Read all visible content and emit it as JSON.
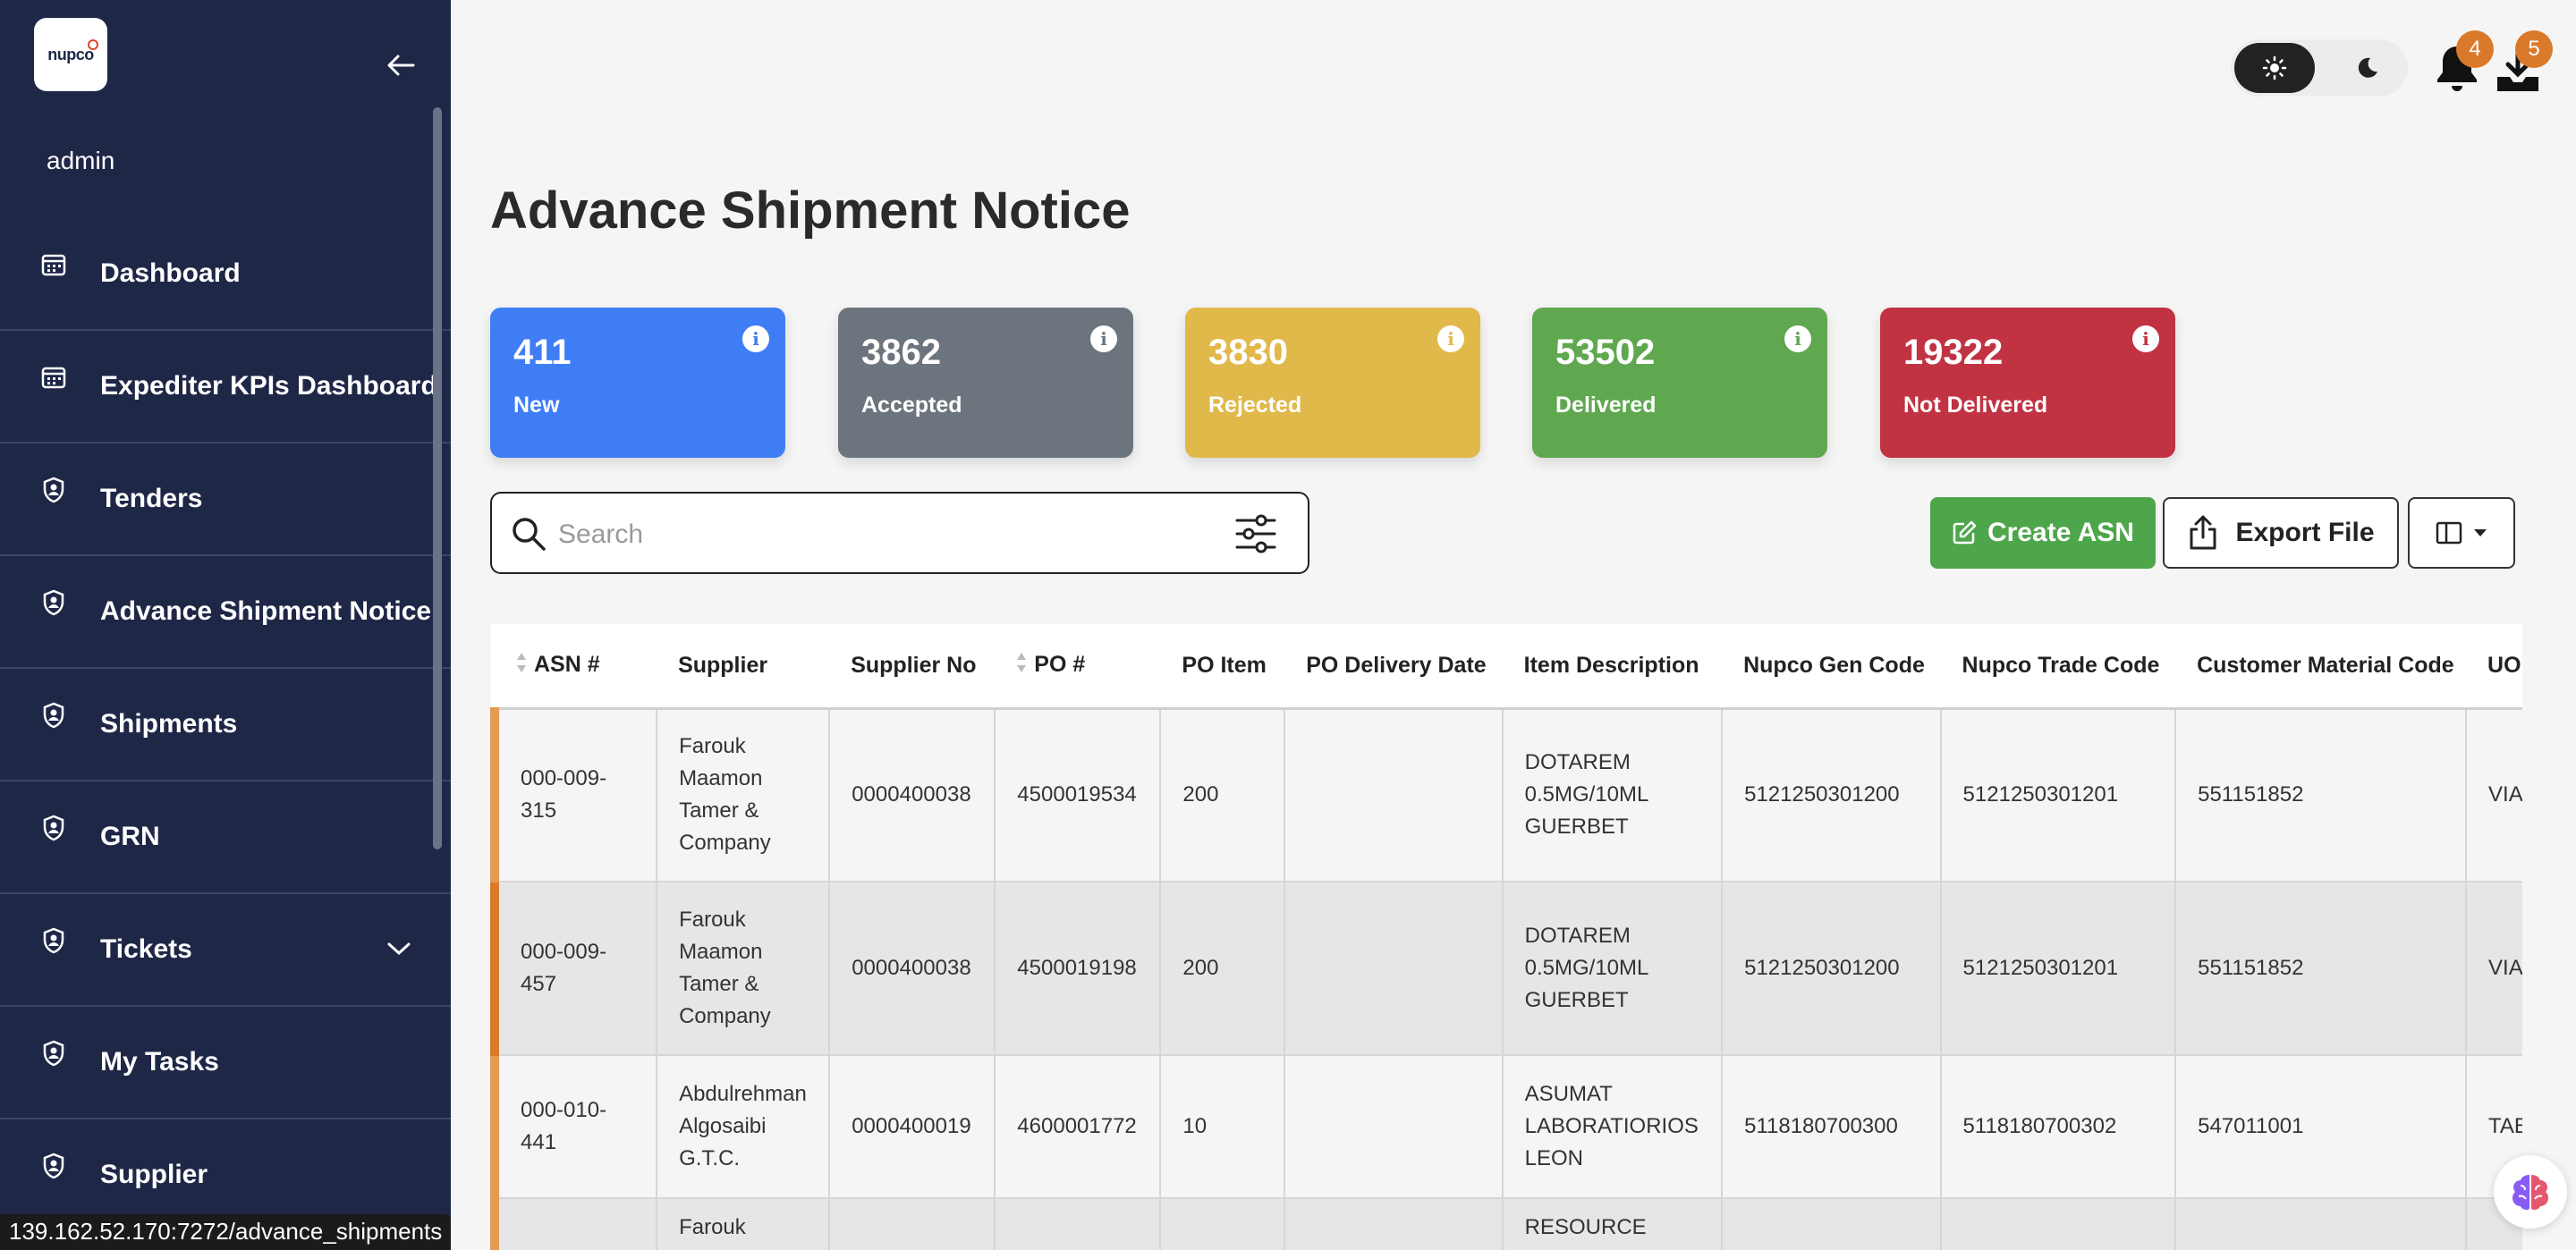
{
  "sidebar": {
    "logo_text": "nupco",
    "user": "admin",
    "items": [
      {
        "label": "Dashboard"
      },
      {
        "label": "Expediter KPIs Dashboard"
      },
      {
        "label": "Tenders"
      },
      {
        "label": "Advance Shipment Notice"
      },
      {
        "label": "Shipments"
      },
      {
        "label": "GRN"
      },
      {
        "label": "Tickets"
      },
      {
        "label": "My Tasks"
      },
      {
        "label": "Supplier"
      }
    ]
  },
  "status_url": "139.162.52.170:7272/advance_shipments",
  "header": {
    "notifications_count": "4",
    "downloads_count": "5"
  },
  "page": {
    "title": "Advance Shipment Notice"
  },
  "cards": [
    {
      "value": "411",
      "label": "New",
      "color": "#3f7df5"
    },
    {
      "value": "3862",
      "label": "Accepted",
      "color": "#6c757d"
    },
    {
      "value": "3830",
      "label": "Rejected",
      "color": "#e1b84a"
    },
    {
      "value": "53502",
      "label": "Delivered",
      "color": "#5fa84f"
    },
    {
      "value": "19322",
      "label": "Not Delivered",
      "color": "#c13343"
    }
  ],
  "search": {
    "placeholder": "Search"
  },
  "actions": {
    "create": "Create ASN",
    "export": "Export File"
  },
  "table": {
    "headers": [
      "ASN #",
      "Supplier",
      "Supplier No",
      "PO #",
      "PO Item",
      "PO Delivery Date",
      "Item Description",
      "Nupco Gen Code",
      "Nupco Trade Code",
      "Customer Material Code",
      "UOM"
    ],
    "rows": [
      {
        "asn": "000-009-315",
        "supplier": "Farouk Maamon Tamer & Company",
        "supplier_no": "0000400038",
        "po": "4500019534",
        "po_item": "200",
        "po_date": "",
        "desc": "DOTAREM 0.5MG/10ML GUERBET",
        "gen": "5121250301200",
        "trade": "5121250301201",
        "cust": "551151852",
        "uom": "VIA"
      },
      {
        "asn": "000-009-457",
        "supplier": "Farouk Maamon Tamer & Company",
        "supplier_no": "0000400038",
        "po": "4500019198",
        "po_item": "200",
        "po_date": "",
        "desc": "DOTAREM 0.5MG/10ML GUERBET",
        "gen": "5121250301200",
        "trade": "5121250301201",
        "cust": "551151852",
        "uom": "VIA"
      },
      {
        "asn": "000-010-441",
        "supplier": "Abdulrehman Algosaibi G.T.C.",
        "supplier_no": "0000400019",
        "po": "4600001772",
        "po_item": "10",
        "po_date": "",
        "desc": "ASUMAT LABORATIORIOS LEON",
        "gen": "5118180700300",
        "trade": "5118180700302",
        "cust": "547011001",
        "uom": "TAB"
      },
      {
        "asn": "",
        "supplier": "Farouk",
        "supplier_no": "",
        "po": "",
        "po_item": "",
        "po_date": "",
        "desc": "RESOURCE",
        "gen": "",
        "trade": "",
        "cust": "",
        "uom": ""
      }
    ]
  }
}
